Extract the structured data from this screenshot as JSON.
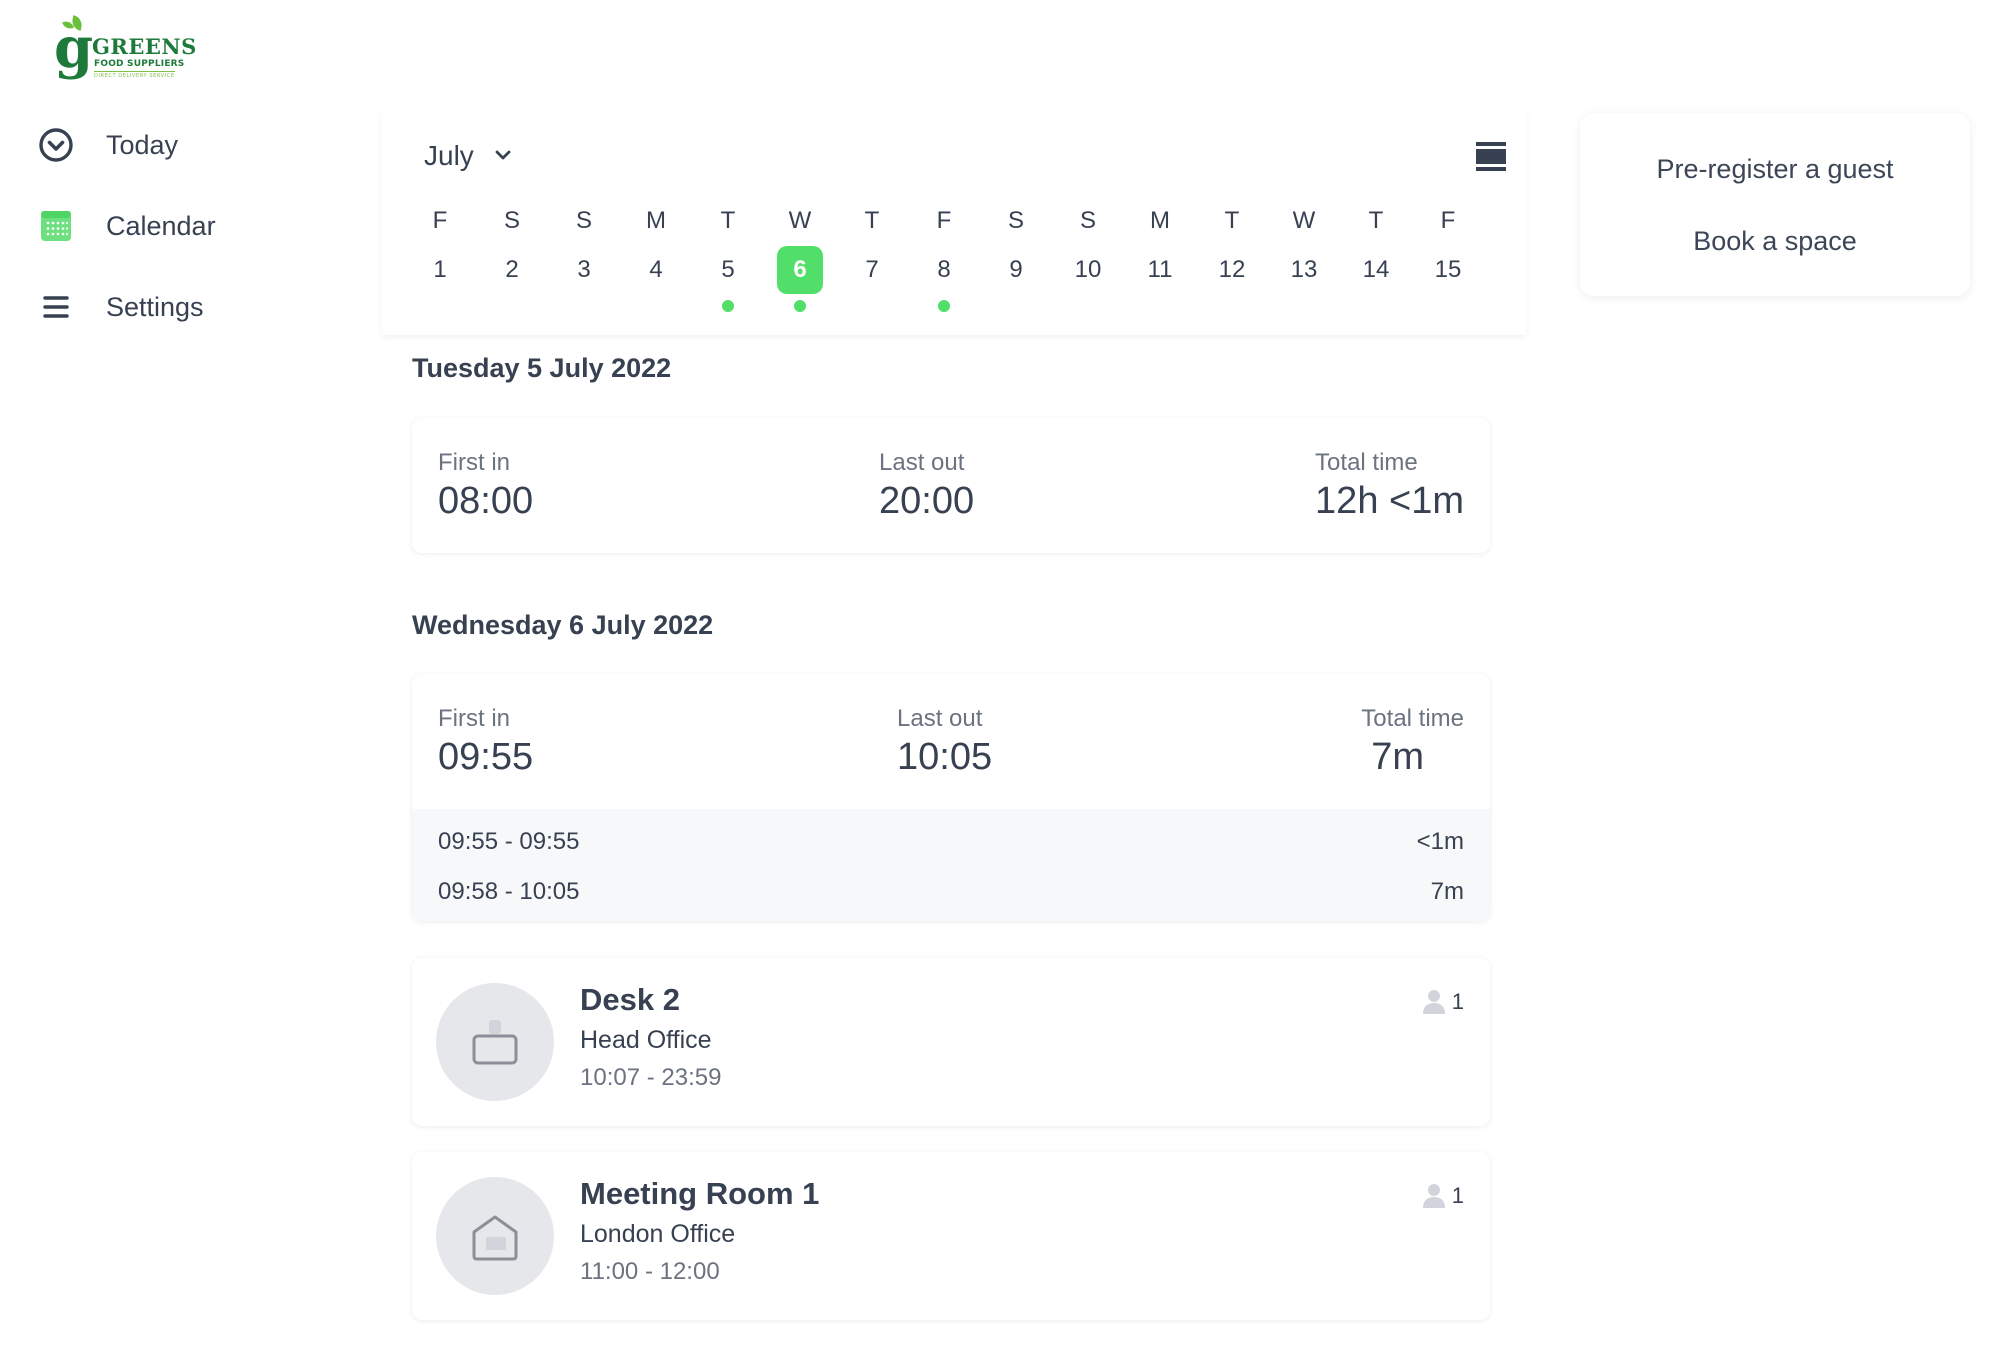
{
  "brand": {
    "name": "GREENS",
    "subtitle": "FOOD SUPPLIERS",
    "tagline": "DIRECT DELIVERY SERVICE",
    "logo_letter": "g",
    "colors": {
      "primary": "#1e7a3a",
      "leaf": "#6abf3b"
    }
  },
  "sidebar": {
    "items": [
      {
        "label": "Today",
        "icon": "chevron-circle-down-icon"
      },
      {
        "label": "Calendar",
        "icon": "calendar-icon",
        "active": true
      },
      {
        "label": "Settings",
        "icon": "menu-icon"
      }
    ]
  },
  "calendar": {
    "month": "July",
    "view_toggle_icon": "list-view-icon",
    "accent_color": "#51df6a",
    "days": [
      {
        "dow": "F",
        "num": "1",
        "event": false,
        "selected": false
      },
      {
        "dow": "S",
        "num": "2",
        "event": false,
        "selected": false
      },
      {
        "dow": "S",
        "num": "3",
        "event": false,
        "selected": false
      },
      {
        "dow": "M",
        "num": "4",
        "event": false,
        "selected": false
      },
      {
        "dow": "T",
        "num": "5",
        "event": true,
        "selected": false
      },
      {
        "dow": "W",
        "num": "6",
        "event": true,
        "selected": true
      },
      {
        "dow": "T",
        "num": "7",
        "event": false,
        "selected": false
      },
      {
        "dow": "F",
        "num": "8",
        "event": true,
        "selected": false
      },
      {
        "dow": "S",
        "num": "9",
        "event": false,
        "selected": false
      },
      {
        "dow": "S",
        "num": "10",
        "event": false,
        "selected": false
      },
      {
        "dow": "M",
        "num": "11",
        "event": false,
        "selected": false
      },
      {
        "dow": "T",
        "num": "12",
        "event": false,
        "selected": false
      },
      {
        "dow": "W",
        "num": "13",
        "event": false,
        "selected": false
      },
      {
        "dow": "T",
        "num": "14",
        "event": false,
        "selected": false
      },
      {
        "dow": "F",
        "num": "15",
        "event": false,
        "selected": false
      }
    ]
  },
  "actions": {
    "pre_register": "Pre-register a guest",
    "book_space": "Book a space"
  },
  "days": [
    {
      "heading": "Tuesday 5 July 2022",
      "attendance": {
        "first_in_label": "First in",
        "first_in": "08:00",
        "last_out_label": "Last out",
        "last_out": "20:00",
        "total_label": "Total time",
        "total": "12h <1m",
        "sessions": []
      }
    },
    {
      "heading": "Wednesday 6 July 2022",
      "attendance": {
        "first_in_label": "First in",
        "first_in": "09:55",
        "last_out_label": "Last out",
        "last_out": "10:05",
        "total_label": "Total time",
        "total": "7m",
        "sessions": [
          {
            "range": "09:55 - 09:55",
            "duration": "<1m"
          },
          {
            "range": "09:58 - 10:05",
            "duration": "7m"
          }
        ]
      },
      "bookings": [
        {
          "title": "Desk 2",
          "location": "Head Office",
          "time": "10:07 - 23:59",
          "capacity": "1",
          "icon": "desk-icon"
        },
        {
          "title": "Meeting Room 1",
          "location": "London Office",
          "time": "11:00 - 12:00",
          "capacity": "1",
          "icon": "meeting-room-icon"
        }
      ]
    }
  ]
}
